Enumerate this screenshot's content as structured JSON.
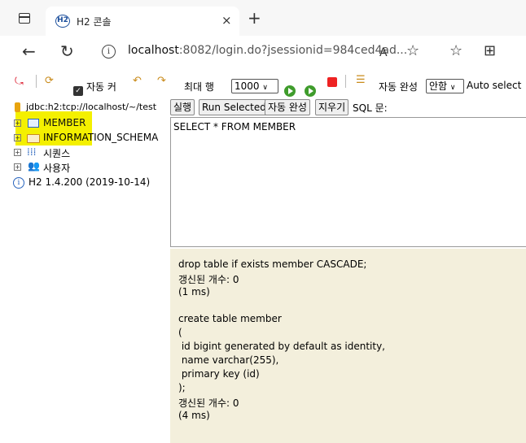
{
  "browser": {
    "tab_title": "H2 콘솔",
    "tab_favicon": "H2",
    "tab_close": "×",
    "new_tab": "+",
    "back": "←",
    "reload": "↻",
    "url_host": "localhost",
    "url_rest": ":8082/login.do?jsessionid=984ced4ad...",
    "read_aloud": "A",
    "favorites_add": "☆",
    "favorites": "☆",
    "collections": "⊞"
  },
  "toolbar": {
    "autocommit_label": "자동 커",
    "max_rows_label": "최대 행",
    "max_rows_value": "1000",
    "autocomplete_label": "자동 완성",
    "autocomplete_value": "안함",
    "autoselect_label": "Auto select"
  },
  "tree": {
    "connection": "jdbc:h2:tcp://localhost/~/test",
    "items": [
      {
        "label": "MEMBER"
      },
      {
        "label": "INFORMATION_SCHEMA"
      },
      {
        "label": "시퀀스"
      },
      {
        "label": "사용자"
      }
    ],
    "version": "H2 1.4.200 (2019-10-14)"
  },
  "buttons": {
    "run": "실행",
    "run_selected": "Run Selected",
    "autocomplete": "자동 완성",
    "clear": "지우기",
    "sql_label": "SQL 문:"
  },
  "editor": {
    "sql": "SELECT * FROM MEMBER"
  },
  "result": {
    "lines": [
      "drop table if exists member CASCADE;",
      "갱신된 개수: 0",
      "(1 ms)",
      "",
      "create table member",
      "(",
      " id bigint generated by default as identity,",
      " name varchar(255),",
      " primary key (id)",
      ");",
      "갱신된 개수: 0",
      "(4 ms)"
    ]
  },
  "colors": {
    "highlight": "#f4f000",
    "result_bg": "#f3efdc",
    "run_icon": "#3f9c2c",
    "stop_icon": "#e22222"
  }
}
